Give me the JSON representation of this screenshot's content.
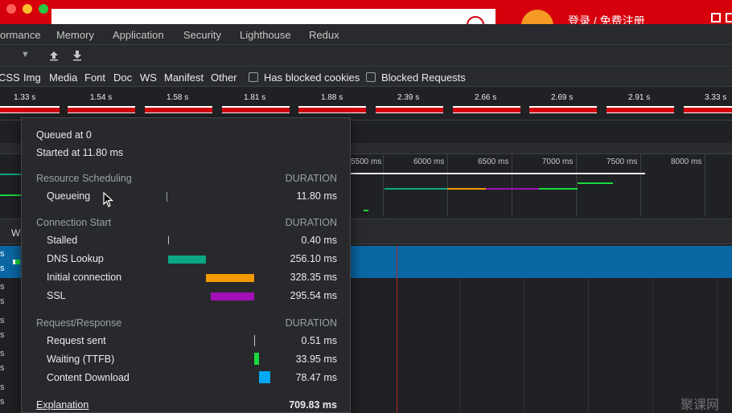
{
  "browser": {
    "login_text": "登录 / 免费注册",
    "brand_red": "#d5000c"
  },
  "devtools_tabs": [
    {
      "label": "ormance"
    },
    {
      "label": "Memory"
    },
    {
      "label": "Application"
    },
    {
      "label": "Security"
    },
    {
      "label": "Lighthouse"
    },
    {
      "label": "Redux"
    }
  ],
  "toolbar": {
    "dropdown_icon": "chevron-down-icon",
    "upload_icon": "upload-icon",
    "download_icon": "download-icon"
  },
  "filters": {
    "types": [
      "CSS",
      "Img",
      "Media",
      "Font",
      "Doc",
      "WS",
      "Manifest",
      "Other"
    ],
    "checkboxes": [
      {
        "label": "Has blocked cookies",
        "checked": false
      },
      {
        "label": "Blocked Requests",
        "checked": false
      }
    ]
  },
  "filmstrip": {
    "times": [
      "1.33 s",
      "1.54 s",
      "1.58 s",
      "1.81 s",
      "1.88 s",
      "2.39 s",
      "2.66 s",
      "2.69 s",
      "2.91 s",
      "3.33 s"
    ]
  },
  "overview": {
    "ticks": [
      "5500 ms",
      "6000 ms",
      "6500 ms",
      "7000 ms",
      "7500 ms",
      "8000 ms"
    ]
  },
  "table": {
    "partial_header": "W",
    "left_fragments": [
      "s",
      "s",
      "s",
      "s",
      "s",
      "s",
      "s",
      "s",
      "s",
      "s",
      "s"
    ]
  },
  "timing": {
    "queued_at": "Queued at 0",
    "started_at": "Started at 11.80 ms",
    "duration_header": "DURATION",
    "sections": [
      {
        "title": "Resource Scheduling",
        "rows": [
          {
            "label": "Queueing",
            "value": "11.80 ms",
            "color": "#9aa0a6"
          }
        ]
      },
      {
        "title": "Connection Start",
        "rows": [
          {
            "label": "Stalled",
            "value": "0.40 ms",
            "color": "#9aa0a6"
          },
          {
            "label": "DNS Lookup",
            "value": "256.10 ms",
            "color": "#0aa884"
          },
          {
            "label": "Initial connection",
            "value": "328.35 ms",
            "color": "#f29900"
          },
          {
            "label": "SSL",
            "value": "295.54 ms",
            "color": "#a10fb5"
          }
        ]
      },
      {
        "title": "Request/Response",
        "rows": [
          {
            "label": "Request sent",
            "value": "0.51 ms",
            "color": "#9aa0a6"
          },
          {
            "label": "Waiting (TTFB)",
            "value": "33.95 ms",
            "color": "#1bd83c"
          },
          {
            "label": "Content Download",
            "value": "78.47 ms",
            "color": "#03a9f4"
          }
        ]
      }
    ],
    "explanation_link": "Explanation",
    "total": "709.83 ms"
  },
  "watermark": "聚课网"
}
